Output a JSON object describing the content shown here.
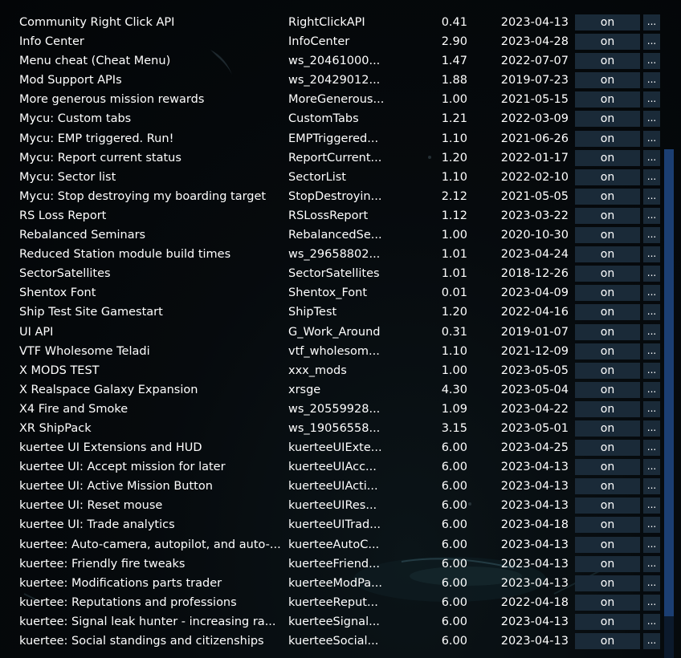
{
  "mods": [
    {
      "name": "Community Right Click API",
      "id": "RightClickAPI",
      "version": "0.41",
      "date": "2023-04-13",
      "status": "on",
      "more": "..."
    },
    {
      "name": "Info Center",
      "id": "InfoCenter",
      "version": "2.90",
      "date": "2023-04-28",
      "status": "on",
      "more": "..."
    },
    {
      "name": "Menu cheat (Cheat Menu)",
      "id": "ws_20461000...",
      "version": "1.47",
      "date": "2022-07-07",
      "status": "on",
      "more": "..."
    },
    {
      "name": "Mod Support APIs",
      "id": "ws_20429012...",
      "version": "1.88",
      "date": "2019-07-23",
      "status": "on",
      "more": "..."
    },
    {
      "name": "More generous mission rewards",
      "id": "MoreGenerous...",
      "version": "1.00",
      "date": "2021-05-15",
      "status": "on",
      "more": "..."
    },
    {
      "name": "Mycu: Custom tabs",
      "id": "CustomTabs",
      "version": "1.21",
      "date": "2022-03-09",
      "status": "on",
      "more": "..."
    },
    {
      "name": "Mycu: EMP triggered. Run!",
      "id": "EMPTriggered...",
      "version": "1.10",
      "date": "2021-06-26",
      "status": "on",
      "more": "..."
    },
    {
      "name": "Mycu: Report current status",
      "id": "ReportCurrent...",
      "version": "1.20",
      "date": "2022-01-17",
      "status": "on",
      "more": "..."
    },
    {
      "name": "Mycu: Sector list",
      "id": "SectorList",
      "version": "1.10",
      "date": "2022-02-10",
      "status": "on",
      "more": "..."
    },
    {
      "name": "Mycu: Stop destroying my boarding target",
      "id": "StopDestroyin...",
      "version": "2.12",
      "date": "2021-05-05",
      "status": "on",
      "more": "..."
    },
    {
      "name": "RS Loss Report",
      "id": "RSLossReport",
      "version": "1.12",
      "date": "2023-03-22",
      "status": "on",
      "more": "..."
    },
    {
      "name": "Rebalanced Seminars",
      "id": "RebalancedSe...",
      "version": "1.00",
      "date": "2020-10-30",
      "status": "on",
      "more": "..."
    },
    {
      "name": "Reduced Station module build times",
      "id": "ws_29658802...",
      "version": "1.01",
      "date": "2023-04-24",
      "status": "on",
      "more": "..."
    },
    {
      "name": "SectorSatellites",
      "id": "SectorSatellites",
      "version": "1.01",
      "date": "2018-12-26",
      "status": "on",
      "more": "..."
    },
    {
      "name": "Shentox Font",
      "id": "Shentox_Font",
      "version": "0.01",
      "date": "2023-04-09",
      "status": "on",
      "more": "..."
    },
    {
      "name": "Ship Test Site Gamestart",
      "id": "ShipTest",
      "version": "1.20",
      "date": "2022-04-16",
      "status": "on",
      "more": "..."
    },
    {
      "name": "UI API",
      "id": "G_Work_Around",
      "version": "0.31",
      "date": "2019-01-07",
      "status": "on",
      "more": "..."
    },
    {
      "name": "VTF Wholesome Teladi",
      "id": "vtf_wholesom...",
      "version": "1.10",
      "date": "2021-12-09",
      "status": "on",
      "more": "..."
    },
    {
      "name": "X MODS TEST",
      "id": "xxx_mods",
      "version": "1.00",
      "date": "2023-05-05",
      "status": "on",
      "more": "..."
    },
    {
      "name": "X Realspace Galaxy Expansion",
      "id": "xrsge",
      "version": "4.30",
      "date": "2023-05-04",
      "status": "on",
      "more": "..."
    },
    {
      "name": "X4 Fire and Smoke",
      "id": "ws_20559928...",
      "version": "1.09",
      "date": "2023-04-22",
      "status": "on",
      "more": "..."
    },
    {
      "name": "XR ShipPack",
      "id": "ws_19056558...",
      "version": "3.15",
      "date": "2023-05-01",
      "status": "on",
      "more": "..."
    },
    {
      "name": "kuertee UI Extensions and HUD",
      "id": "kuerteeUIExte...",
      "version": "6.00",
      "date": "2023-04-25",
      "status": "on",
      "more": "..."
    },
    {
      "name": "kuertee UI: Accept mission for later",
      "id": "kuerteeUIAcc...",
      "version": "6.00",
      "date": "2023-04-13",
      "status": "on",
      "more": "..."
    },
    {
      "name": "kuertee UI: Active Mission Button",
      "id": "kuerteeUIActi...",
      "version": "6.00",
      "date": "2023-04-13",
      "status": "on",
      "more": "..."
    },
    {
      "name": "kuertee UI: Reset mouse",
      "id": "kuerteeUIRes...",
      "version": "6.00",
      "date": "2023-04-13",
      "status": "on",
      "more": "..."
    },
    {
      "name": "kuertee UI: Trade analytics",
      "id": "kuerteeUITrad...",
      "version": "6.00",
      "date": "2023-04-18",
      "status": "on",
      "more": "..."
    },
    {
      "name": "kuertee: Auto-camera, autopilot, and auto-...",
      "id": "kuerteeAutoC...",
      "version": "6.00",
      "date": "2023-04-13",
      "status": "on",
      "more": "..."
    },
    {
      "name": "kuertee: Friendly fire tweaks",
      "id": "kuerteeFriend...",
      "version": "6.00",
      "date": "2023-04-13",
      "status": "on",
      "more": "..."
    },
    {
      "name": "kuertee: Modifications parts trader",
      "id": "kuerteeModPa...",
      "version": "6.00",
      "date": "2023-04-13",
      "status": "on",
      "more": "..."
    },
    {
      "name": "kuertee: Reputations and professions",
      "id": "kuerteeReput...",
      "version": "6.00",
      "date": "2022-04-18",
      "status": "on",
      "more": "..."
    },
    {
      "name": "kuertee: Signal leak hunter - increasing ra...",
      "id": "kuerteeSignal...",
      "version": "6.00",
      "date": "2023-04-13",
      "status": "on",
      "more": "..."
    },
    {
      "name": "kuertee: Social standings and citizenships",
      "id": "kuerteeSocial...",
      "version": "6.00",
      "date": "2023-04-13",
      "status": "on",
      "more": "..."
    }
  ],
  "colors": {
    "background": "#05090c",
    "button": "#1a2a38",
    "scrollbar_thumb": "#1b3e72",
    "text": "#ffffff"
  }
}
